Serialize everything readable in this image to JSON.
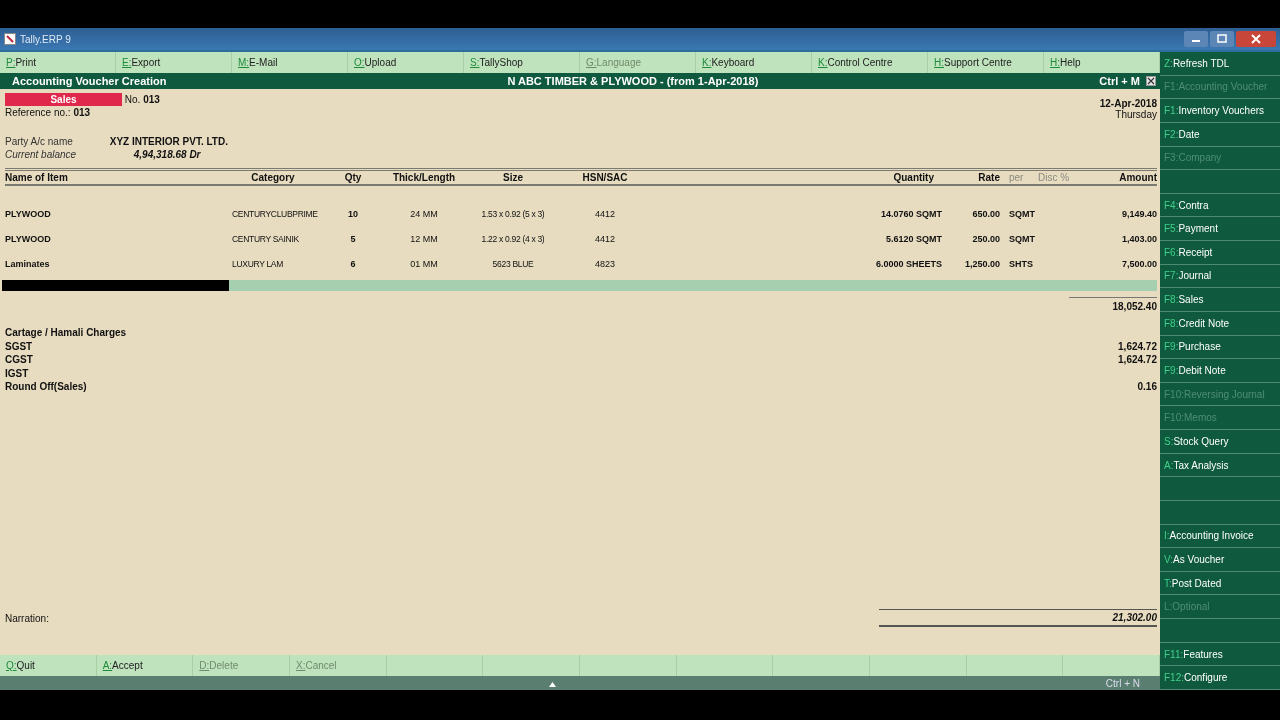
{
  "window": {
    "title": "Tally.ERP 9"
  },
  "top_buttons": [
    {
      "key": "P:",
      "label": "Print",
      "disabled": false
    },
    {
      "key": "E:",
      "label": "Export",
      "disabled": false
    },
    {
      "key": "M:",
      "label": "E-Mail",
      "disabled": false
    },
    {
      "key": "O:",
      "label": "Upload",
      "disabled": false
    },
    {
      "key": "S:",
      "label": "TallyShop",
      "disabled": false
    },
    {
      "key": "G:",
      "label": "Language",
      "disabled": true
    },
    {
      "key": "K:",
      "label": "Keyboard",
      "disabled": false
    },
    {
      "key": "K:",
      "label": "Control Centre",
      "disabled": false
    },
    {
      "key": "H:",
      "label": "Support Centre",
      "disabled": false
    },
    {
      "key": "H:",
      "label": "Help",
      "disabled": false
    }
  ],
  "voucher_bar": {
    "title": "Accounting Voucher  Creation",
    "company": "N ABC TIMBER & PLYWOOD - (from 1-Apr-2018)",
    "shortcut": "Ctrl + M"
  },
  "voucher": {
    "type": "Sales",
    "number_label": "No.",
    "number": "013",
    "reference_label": "Reference no.:",
    "reference": "013",
    "date": "12-Apr-2018",
    "day": "Thursday",
    "party_label": "Party A/c name",
    "party": "XYZ INTERIOR PVT. LTD.",
    "balance_label": "Current balance",
    "balance": "4,94,318.68 Dr"
  },
  "columns": [
    "Name of Item",
    "Category",
    "Qty",
    "Thick/Length",
    "Size",
    "HSN/SAC",
    "Quantity",
    "Rate",
    "per",
    "Disc %",
    "Amount"
  ],
  "rows": [
    {
      "name": "PLYWOOD",
      "category": "CENTURYCLUBPRIME",
      "qty": "10",
      "thick": "24 MM",
      "size": "1.53 x 0.92 (5 x 3)",
      "hsn": "4412",
      "quantity": "14.0760 SQMT",
      "rate": "650.00",
      "per": "SQMT",
      "amount": "9,149.40"
    },
    {
      "name": "PLYWOOD",
      "category": "CENTURY SAINIK",
      "qty": "5",
      "thick": "12 MM",
      "size": "1.22 x 0.92 (4 x 3)",
      "hsn": "4412",
      "quantity": "5.6120 SQMT",
      "rate": "250.00",
      "per": "SQMT",
      "amount": "1,403.00"
    },
    {
      "name": "Laminates",
      "category": "LUXURY LAM",
      "qty": "6",
      "thick": "01 MM",
      "size": "5623 BLUE",
      "hsn": "4823",
      "quantity": "6.0000 SHEETS",
      "rate": "1,250.00",
      "per": "SHTS",
      "amount": "7,500.00"
    }
  ],
  "subtotal": "18,052.40",
  "ledgers": [
    {
      "name": "Cartage / Hamali Charges"
    },
    {
      "name": "SGST",
      "amount": "1,624.72"
    },
    {
      "name": "CGST",
      "amount": "1,624.72"
    },
    {
      "name": "IGST"
    },
    {
      "name": "Round Off(Sales)",
      "amount": "0.16"
    }
  ],
  "narration_label": "Narration:",
  "total": "21,302.00",
  "bottom_buttons": [
    {
      "key": "Q:",
      "label": "Quit",
      "disabled": false
    },
    {
      "key": "A:",
      "label": "Accept",
      "disabled": false
    },
    {
      "key": "D:",
      "label": "Delete",
      "disabled": true
    },
    {
      "key": "X:",
      "label": "Cancel",
      "disabled": true
    }
  ],
  "status_bar": {
    "shortcut": "Ctrl + N"
  },
  "sidebar": [
    {
      "kind": "button",
      "key": "Z:",
      "label": "Refresh TDL",
      "disabled": false
    },
    {
      "kind": "button",
      "key": "F1:",
      "label": "Accounting Voucher",
      "disabled": true
    },
    {
      "kind": "button",
      "key": "F1:",
      "label": "Inventory Vouchers",
      "disabled": false
    },
    {
      "kind": "button",
      "key": "F2:",
      "label": "Date",
      "disabled": false
    },
    {
      "kind": "button",
      "key": "F3:",
      "label": "Company",
      "disabled": true
    },
    {
      "kind": "spacer"
    },
    {
      "kind": "button",
      "key": "F4:",
      "label": "Contra",
      "disabled": false
    },
    {
      "kind": "button",
      "key": "F5:",
      "label": "Payment",
      "disabled": false
    },
    {
      "kind": "button",
      "key": "F6:",
      "label": "Receipt",
      "disabled": false
    },
    {
      "kind": "button",
      "key": "F7:",
      "label": "Journal",
      "disabled": false
    },
    {
      "kind": "button",
      "key": "F8:",
      "label": "Sales",
      "disabled": false
    },
    {
      "kind": "button",
      "key": "F8:",
      "label": "Credit Note",
      "disabled": false
    },
    {
      "kind": "button",
      "key": "F9:",
      "label": "Purchase",
      "disabled": false
    },
    {
      "kind": "button",
      "key": "F9:",
      "label": "Debit Note",
      "disabled": false
    },
    {
      "kind": "button",
      "key": "F10:",
      "label": "Reversing Journal",
      "disabled": true
    },
    {
      "kind": "button",
      "key": "F10:",
      "label": "Memos",
      "disabled": true
    },
    {
      "kind": "button",
      "key": "S:",
      "label": "Stock Query",
      "disabled": false
    },
    {
      "kind": "button",
      "key": "A:",
      "label": "Tax Analysis",
      "disabled": false
    },
    {
      "kind": "spacer"
    },
    {
      "kind": "spacer"
    },
    {
      "kind": "button",
      "key": "I:",
      "label": "Accounting Invoice",
      "disabled": false
    },
    {
      "kind": "button",
      "key": "V:",
      "label": "As Voucher",
      "disabled": false
    },
    {
      "kind": "button",
      "key": "T:",
      "label": "Post Dated",
      "disabled": false
    },
    {
      "kind": "button",
      "key": "L:",
      "label": "Optional",
      "disabled": true
    },
    {
      "kind": "spacer"
    },
    {
      "kind": "button",
      "key": "F11:",
      "label": "Features",
      "disabled": false
    },
    {
      "kind": "button",
      "key": "F12:",
      "label": "Configure",
      "disabled": false
    }
  ]
}
